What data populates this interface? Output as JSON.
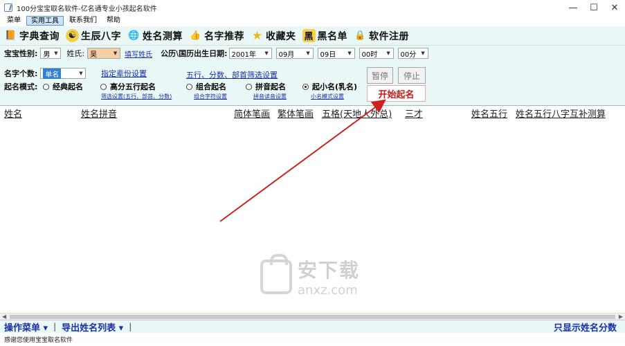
{
  "window": {
    "title": "100分宝宝取名软件-亿名通专业小孩起名软件",
    "controls": [
      "—",
      "☐",
      "✕"
    ]
  },
  "menu": [
    "菜单",
    "实用工具",
    "联系我们",
    "帮助"
  ],
  "toolbar": [
    {
      "label": "字典查询",
      "icon": "dictionary-icon",
      "glyph": "📙"
    },
    {
      "label": "生辰八字",
      "icon": "bagua-icon",
      "glyph": "☯"
    },
    {
      "label": "姓名测算",
      "icon": "globe-icon",
      "glyph": "🌐"
    },
    {
      "label": "名字推荐",
      "icon": "thumbs-up-icon",
      "glyph": "👍"
    },
    {
      "label": "收藏夹",
      "icon": "star-icon",
      "glyph": "★"
    },
    {
      "label": "黑名单",
      "icon": "black-mark-icon",
      "glyph": "黑"
    },
    {
      "label": "软件注册",
      "icon": "lock-icon",
      "glyph": "🔒"
    }
  ],
  "form": {
    "gender_label": "宝宝性别:",
    "gender_value": "男",
    "surname_label": "姓氏:",
    "surname_value": "吴",
    "fill_surname_link": "填写姓氏",
    "birth_label": "公历\\国历出生日期:",
    "year": "2001年",
    "month": "09月",
    "day": "09日",
    "hour": "00时",
    "minute": "00分",
    "name_length_label": "名字个数:",
    "name_length_value": "单名",
    "birth_set_link": "指定辈份设置",
    "filter_link": "五行、分数、部首筛选设置",
    "mode_label": "起名模式:",
    "modes": [
      {
        "label": "经典起名",
        "selected": false,
        "sub": ""
      },
      {
        "label": "高分五行起名",
        "selected": false,
        "sub": "筛选设置(五行、部首、分数)"
      },
      {
        "label": "组合起名",
        "selected": false,
        "sub": "组合字符设置"
      },
      {
        "label": "拼音起名",
        "selected": false,
        "sub": "拼音读音设置"
      },
      {
        "label": "起小名(乳名)",
        "selected": true,
        "sub": "小名模式设置"
      }
    ],
    "pause_label": "暂停",
    "stop_label": "停止",
    "start_label": "开始起名"
  },
  "grid": {
    "columns": [
      "姓名",
      "姓名拼音",
      "简体笔画",
      "繁体笔画",
      "五格(天地人外总)",
      "三才",
      "姓名五行",
      "姓名五行八字互补测算"
    ]
  },
  "watermark": {
    "cn": "安下载",
    "en": "anxz.com"
  },
  "bottom": {
    "ops_menu": "操作菜单",
    "export_list": "导出姓名列表",
    "only_score": "只显示姓名分数"
  },
  "status": "感谢您使用宝宝取名软件",
  "colors": {
    "panel_bg": "#e9f7f6",
    "link": "#1a2ea8",
    "start_red": "#c81818",
    "arrow": "#cc2222"
  }
}
